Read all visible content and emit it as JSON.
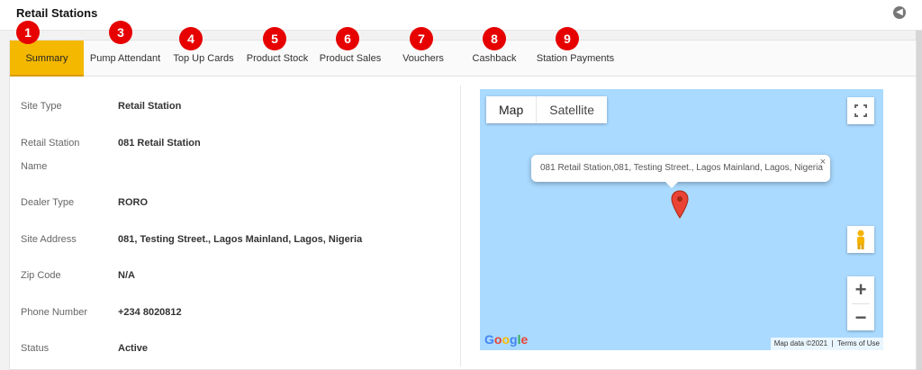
{
  "header": {
    "title": "Retail Stations",
    "back_icon": "back-arrow-icon"
  },
  "tabs": [
    {
      "label": "Summary",
      "badge": "1",
      "active": true
    },
    {
      "label": "Pump Attendant",
      "badge": "3"
    },
    {
      "label": "Top Up Cards",
      "badge": "4"
    },
    {
      "label": "Product Stock",
      "badge": "5"
    },
    {
      "label": "Product Sales",
      "badge": "6"
    },
    {
      "label": "Vouchers",
      "badge": "7"
    },
    {
      "label": "Cashback",
      "badge": "8"
    },
    {
      "label": "Station Payments",
      "badge": "9"
    }
  ],
  "details": [
    {
      "label": "Site Type",
      "value": "Retail Station"
    },
    {
      "label": "Retail Station",
      "label_line2": "Name",
      "value": "081 Retail Station"
    },
    {
      "label": "Dealer Type",
      "value": "RORO"
    },
    {
      "label": "Site Address",
      "value": "081, Testing Street., Lagos Mainland, Lagos, Nigeria"
    },
    {
      "label": "Zip Code",
      "value": "N/A"
    },
    {
      "label": "Phone Number",
      "value": "+234 8020812"
    },
    {
      "label": "Status",
      "value": "Active"
    }
  ],
  "map": {
    "type_map": "Map",
    "type_satellite": "Satellite",
    "info_text": "081 Retail Station,081, Testing Street., Lagos Mainland, Lagos, Nigeria",
    "close_glyph": "×",
    "zoom_in": "+",
    "zoom_out": "−",
    "footer_data": "Map data ©2021",
    "footer_terms": "Terms of Use",
    "logo_text": [
      "G",
      "o",
      "o",
      "g",
      "l",
      "e"
    ]
  },
  "colors": {
    "active_tab": "#f5b800",
    "badge": "#e60000",
    "map_water": "#aadaff",
    "marker": "#ea4335"
  }
}
